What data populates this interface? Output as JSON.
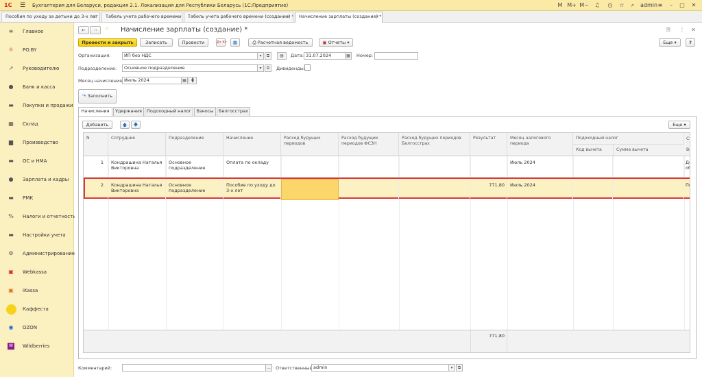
{
  "app": {
    "logo": "1С",
    "title": "Бухгалтерия для Беларуси, редакция 2.1. Локализация для Республики Беларусь   (1С:Предприятие)",
    "user": "admin",
    "toolbar_icons": [
      "M",
      "M+",
      "M−"
    ]
  },
  "tabs": [
    {
      "label": "Пособия по уходу за детьми до 3-х лет"
    },
    {
      "label": "Табель учета рабочего времени"
    },
    {
      "label": "Табель учета рабочего времени (создание) *"
    },
    {
      "label": "Начисление зарплаты (создание) *"
    }
  ],
  "sidebar": {
    "items": [
      {
        "label": "Главное",
        "icon": "≡"
      },
      {
        "label": "PO.BY",
        "icon": "☼"
      },
      {
        "label": "Руководителю",
        "icon": "↗"
      },
      {
        "label": "Банк и касса",
        "icon": "●"
      },
      {
        "label": "Покупки и продажи",
        "icon": "▬"
      },
      {
        "label": "Склад",
        "icon": "▦"
      },
      {
        "label": "Производство",
        "icon": "▆"
      },
      {
        "label": "ОС и НМА",
        "icon": "▬"
      },
      {
        "label": "Зарплата и кадры",
        "icon": "●"
      },
      {
        "label": "РМК",
        "icon": "▬"
      },
      {
        "label": "Налоги и отчетность",
        "icon": "%"
      },
      {
        "label": "Настройки учета",
        "icon": "▬"
      },
      {
        "label": "Администрирование",
        "icon": "⚙"
      },
      {
        "label": "Webkassa",
        "icon": "▣"
      },
      {
        "label": "iKassa",
        "icon": "▣"
      },
      {
        "label": "Каффеста",
        "icon": ""
      },
      {
        "label": "OZON",
        "icon": "◉"
      },
      {
        "label": "Wildberries",
        "icon": "W"
      }
    ]
  },
  "form": {
    "title": "Начисление зарплаты (создание) *",
    "buttons": {
      "post_close": "Провести и закрыть",
      "save": "Записать",
      "post": "Провести",
      "payroll_sheet": "Расчетная ведомость",
      "reports": "Отчеты",
      "more": "Еще",
      "help": "?",
      "fill": "Заполнить"
    },
    "fields": {
      "org_label": "Организация:",
      "org_value": "ИП без НДС",
      "date_label": "Дата:",
      "date_value": "31.07.2024",
      "number_label": "Номер:",
      "number_value": "",
      "dept_label": "Подразделение:",
      "dept_value": "Основное подразделение",
      "dividends_label": "Дивиденды:",
      "month_label": "Месяц начисления:",
      "month_value": "Июль 2024",
      "comment_label": "Комментарий:",
      "comment_value": "",
      "responsible_label": "Ответственный:",
      "responsible_value": "admin"
    },
    "form_tabs": [
      "Начисления",
      "Удержания",
      "Подоходный налог",
      "Взносы",
      "Белгосстрах"
    ],
    "table_toolbar": {
      "add": "Добавить",
      "more": "Еще"
    }
  },
  "table": {
    "headers": {
      "n": "N",
      "employee": "Сотрудник",
      "dept": "Подразделение",
      "accrual": "Начисление",
      "future_exp": "Расход будущих периодов",
      "future_fszn": "Расход будущих периодов ФСЗН",
      "future_bgs": "Расход будущих периодов Белгосстрах",
      "result": "Результат",
      "tax_month": "Месяц налогового периода",
      "income_tax": "Подоходный налог",
      "deduction_code": "Код вычета",
      "deduction_sum": "Сумма вычета",
      "extra_top": "Ст",
      "extra_sub": "Ви"
    },
    "rows": [
      {
        "n": "1",
        "employee": "Кондрашина Наталья Викторовна",
        "dept": "Основное подразделение",
        "accrual": "Оплата по окладу",
        "future_exp": "",
        "future_fszn": "",
        "future_bgs": "",
        "result": "",
        "tax_month": "Июль 2024",
        "deduction_code": "",
        "deduction_sum": "",
        "extra": "До об"
      },
      {
        "n": "2",
        "employee": "Кондрашина Наталья Викторовна",
        "dept": "Основное подразделение",
        "accrual": "Пособие по уходу до 3-х лет",
        "future_exp": "",
        "future_fszn": "",
        "future_bgs": "",
        "result": "771,80",
        "tax_month": "Июль 2024",
        "deduction_code": "",
        "deduction_sum": "",
        "extra": "По"
      }
    ],
    "footer_total": "771,80"
  }
}
